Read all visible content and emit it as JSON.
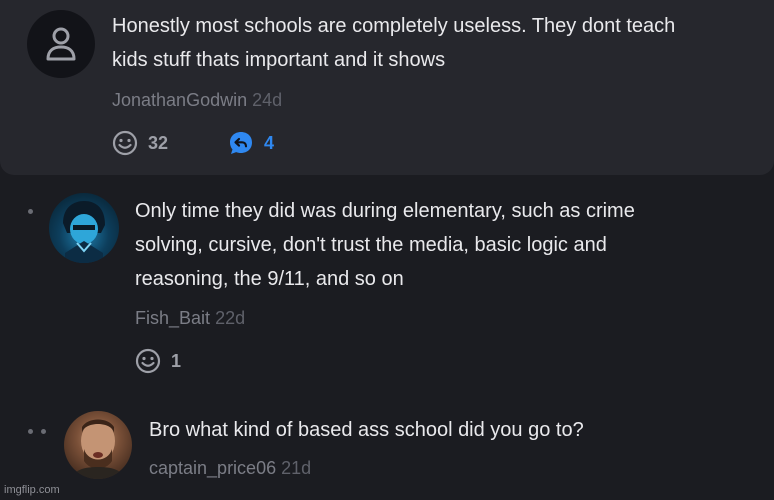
{
  "comments": [
    {
      "text_line1": "Honestly most schools are completely useless. They dont teach",
      "text_line2": "kids stuff thats important and it shows",
      "author": "JonathanGodwin",
      "age": "24d",
      "reactions": "32",
      "replies": "4",
      "avatar_icon": "person-icon"
    },
    {
      "text_line1": "Only time they did was during elementary, such as crime",
      "text_line2": "solving, cursive, don't trust the media, basic logic and",
      "text_line3": "reasoning, the 9/11, and so on",
      "author": "Fish_Bait",
      "age": "22d",
      "reactions": "1"
    },
    {
      "text_line1": "Bro what kind of based ass school did you go to?",
      "author": "captain_price06",
      "age": "21d"
    }
  ],
  "watermark": "imgflip.com",
  "colors": {
    "background": "#1b1c21",
    "card": "#26272d",
    "reply_accent": "#2f88f0"
  }
}
